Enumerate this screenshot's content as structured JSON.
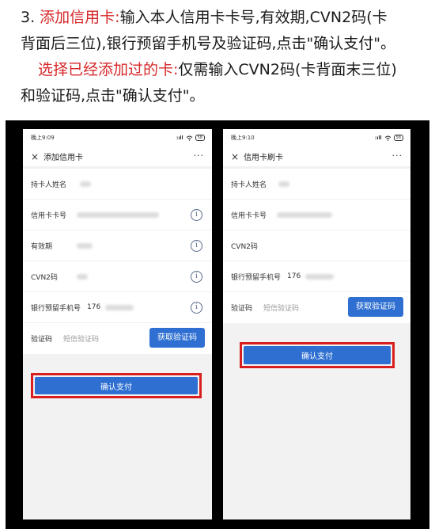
{
  "instructions": {
    "step_prefix": "3. ",
    "step1_title": "添加信用卡:",
    "step1_text_a": "输入本人信用卡卡号,有效期,CVN2码(卡",
    "step1_text_b": "背面后三位),银行预留手机号及验证码,点击\"确认支付\"。",
    "step2_title": "选择已经添加过的卡:",
    "step2_text_a": "仅需输入CVN2码(卡背面末三位)",
    "step2_text_b": "和验证码,点击\"确认支付\"。"
  },
  "colors": {
    "accent": "#2e6fd1",
    "highlight": "#d81e1e",
    "red_text": "#d6282a"
  },
  "phone_left": {
    "status": {
      "time": "晚上9:09",
      "signal": ":ıll",
      "battery": "58"
    },
    "nav": {
      "close_icon": "×",
      "title": "添加信用卡",
      "more": "···"
    },
    "rows": {
      "holder": {
        "label": "持卡人姓名"
      },
      "card_no": {
        "label": "信用卡卡号"
      },
      "expiry": {
        "label": "有效期"
      },
      "cvn2": {
        "label": "CVN2码"
      },
      "phone": {
        "label": "银行预留手机号",
        "value": "176"
      },
      "code": {
        "label": "验证码",
        "placeholder": "短信验证码",
        "button": "获取验证码"
      }
    },
    "info_icon": "i",
    "confirm": "确认支付"
  },
  "phone_right": {
    "status": {
      "time": "晚上9:10",
      "signal": ":ıll",
      "battery": "58"
    },
    "nav": {
      "close_icon": "×",
      "title": "信用卡刷卡",
      "more": "···"
    },
    "rows": {
      "holder": {
        "label": "持卡人姓名"
      },
      "card_no": {
        "label": "信用卡卡号"
      },
      "cvn2": {
        "label": "CVN2码"
      },
      "phone": {
        "label": "银行预留手机号",
        "value": "176"
      },
      "code": {
        "label": "验证码",
        "placeholder": "短信验证码",
        "button": "获取验证码"
      }
    },
    "confirm": "确认支付"
  }
}
